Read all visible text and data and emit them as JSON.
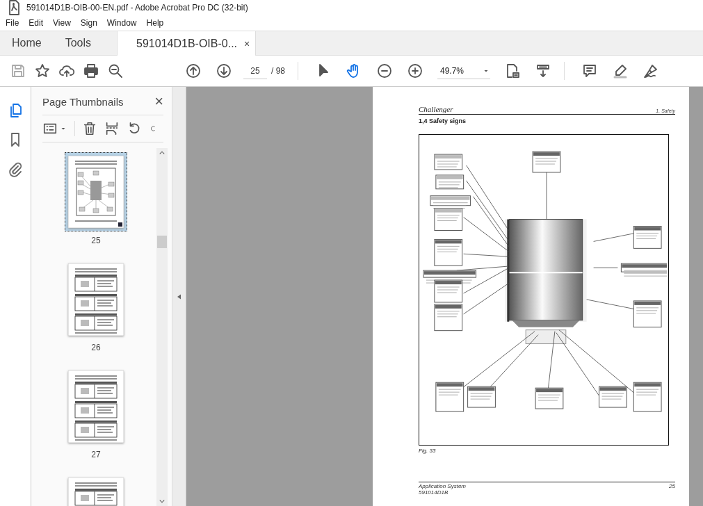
{
  "window": {
    "title": "591014D1B-OIB-00-EN.pdf - Adobe Acrobat Pro DC (32-bit)"
  },
  "menu": [
    "File",
    "Edit",
    "View",
    "Sign",
    "Window",
    "Help"
  ],
  "tabs": [
    {
      "label": "Home",
      "kind": "nav",
      "selected": false
    },
    {
      "label": "Tools",
      "kind": "nav",
      "selected": false
    },
    {
      "label": "591014D1B-OIB-0...",
      "kind": "document",
      "selected": true,
      "close": "×"
    }
  ],
  "toolbar": {
    "page": "25",
    "page_total": "/ 98",
    "zoom": "49.7%"
  },
  "sidebar": {
    "items": [
      {
        "kind": "pages",
        "selected": true
      },
      {
        "kind": "bookmarks",
        "selected": false
      },
      {
        "kind": "attachments",
        "selected": false
      }
    ]
  },
  "panel": {
    "title": "Page Thumbnails",
    "close": "×",
    "thumbnails": [
      {
        "label": "25",
        "kind": "diagram",
        "selected": true
      },
      {
        "label": "26",
        "kind": "table",
        "selected": false
      },
      {
        "label": "27",
        "kind": "table",
        "selected": false
      },
      {
        "kind": "table",
        "selected": false
      }
    ]
  },
  "page": {
    "logo": "Challenger",
    "chapter": "1. Safety",
    "heading": "1,4   Safety signs",
    "caption": "Fig. 33",
    "footer_title": "Application System",
    "footer_code": "591014D1B",
    "footer_page": "25"
  }
}
